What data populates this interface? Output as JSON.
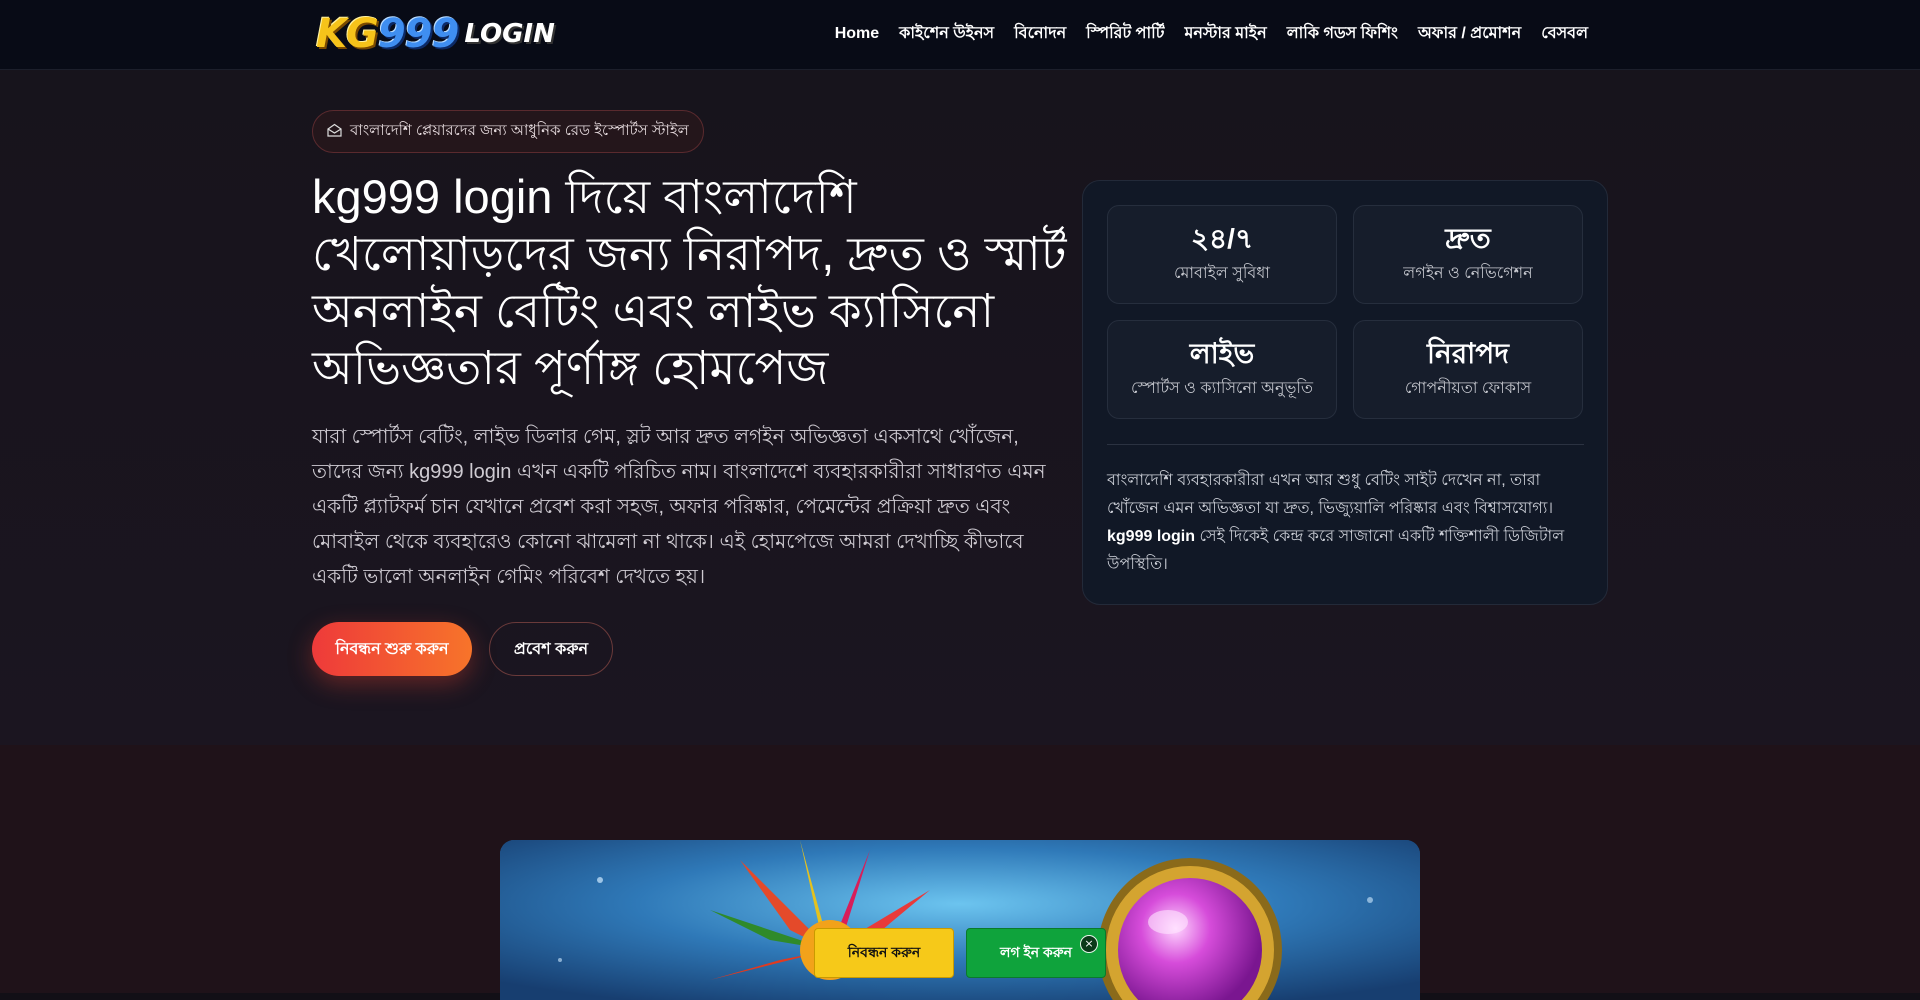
{
  "brand": {
    "logo_kg": "KG",
    "logo_num": "999",
    "logo_login": "LOGIN"
  },
  "nav": {
    "items": [
      {
        "label": "Home"
      },
      {
        "label": "কাইশেন উইনস"
      },
      {
        "label": "বিনোদন"
      },
      {
        "label": "স্পিরিট পার্টি"
      },
      {
        "label": "মনস্টার মাইন"
      },
      {
        "label": "লাকি গডস ফিশিং"
      },
      {
        "label": "অফার / প্রমোশন"
      },
      {
        "label": "বেসবল"
      }
    ]
  },
  "hero": {
    "badge_text": "বাংলাদেশি প্লেয়ারদের জন্য আধুনিক রেড ইস্পোর্টস স্টাইল",
    "headline": "kg999 login দিয়ে বাংলাদেশি খেলোয়াড়দের জন্য নিরাপদ, দ্রুত ও স্মার্ট অনলাইন বেটিং এবং লাইভ ক্যাসিনো অভিজ্ঞতার পূর্ণাঙ্গ হোমপেজ",
    "lead": "যারা স্পোর্টস বেটিং, লাইভ ডিলার গেম, স্লট আর দ্রুত লগইন অভিজ্ঞতা একসাথে খোঁজেন, তাদের জন্য kg999 login এখন একটি পরিচিত নাম। বাংলাদেশে ব্যবহারকারীরা সাধারণত এমন একটি প্ল্যাটফর্ম চান যেখানে প্রবেশ করা সহজ, অফার পরিষ্কার, পেমেন্টের প্রক্রিয়া দ্রুত এবং মোবাইল থেকে ব্যবহারেও কোনো ঝামেলা না থাকে। এই হোমপেজে আমরা দেখাচ্ছি কীভাবে একটি ভালো অনলাইন গেমিং পরিবেশ দেখতে হয়।",
    "primary_cta": "নিবন্ধন শুরু করুন",
    "secondary_cta": "প্রবেশ করুন"
  },
  "stats": {
    "items": [
      {
        "value": "২৪/৭",
        "caption": "মোবাইল সুবিধা"
      },
      {
        "value": "দ্রুত",
        "caption": "লগইন ও নেভিগেশন"
      },
      {
        "value": "লাইভ",
        "caption": "স্পোর্টস ও ক্যাসিনো অনুভূতি"
      },
      {
        "value": "নিরাপদ",
        "caption": "গোপনীয়তা ফোকাস"
      }
    ],
    "desc_before": "বাংলাদেশি ব্যবহারকারীরা এখন আর শুধু বেটিং সাইট দেখেন না, তারা খোঁজেন এমন অভিজ্ঞতা যা দ্রুত, ভিজ্যুয়ালি পরিষ্কার এবং বিশ্বাসযোগ্য।",
    "desc_bold": "kg999 login",
    "desc_after": " সেই দিকেই কেন্দ্র করে সাজানো একটি শক্তিশালী ডিজিটাল উপস্থিতি।"
  },
  "floating_bar": {
    "register_label": "নিবন্ধন করুন",
    "login_label": "লগ ইন করুন",
    "close_glyph": "×"
  },
  "icons": {
    "badge_icon": "mail-open-icon"
  },
  "colors": {
    "accent_red": "#ee3a3a",
    "accent_orange": "#f7742a",
    "register_yellow": "#f6c919",
    "login_green": "#0fa33c"
  }
}
